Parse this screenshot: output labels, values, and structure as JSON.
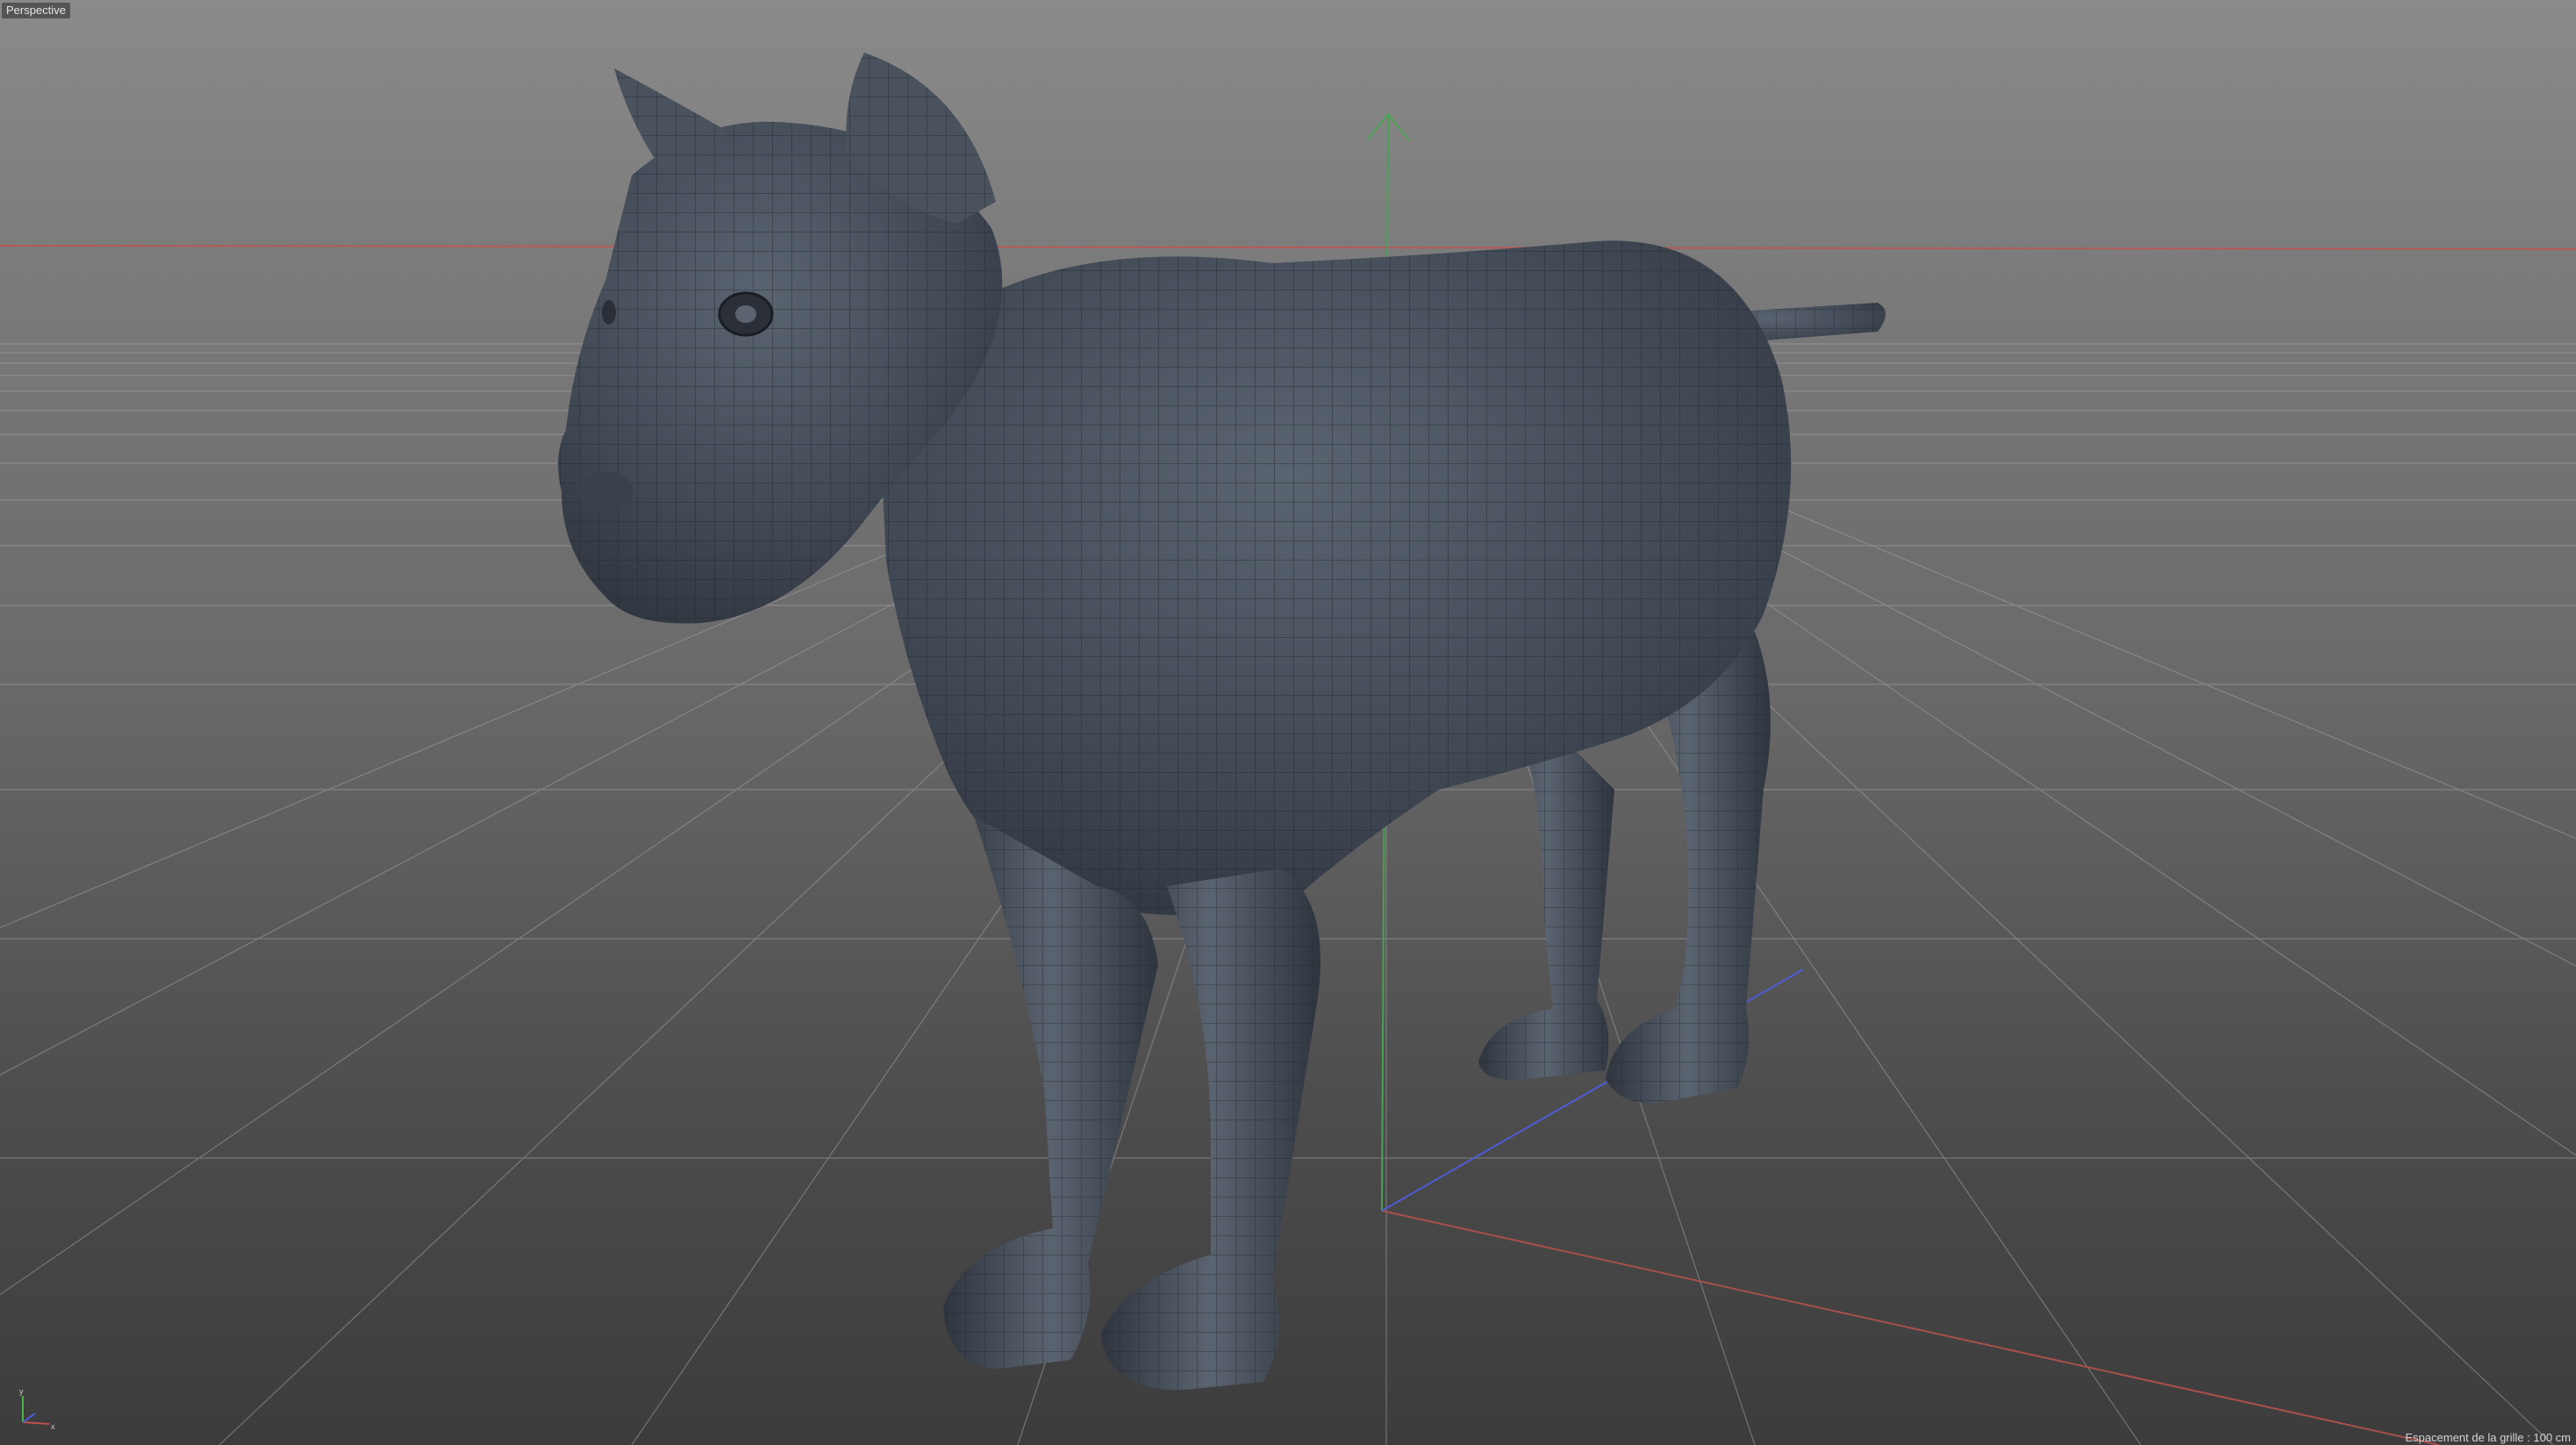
{
  "viewport": {
    "camera_label": "Perspective",
    "grid_spacing_label": "Espacement de la grille : 100 cm"
  },
  "gizmo": {
    "x_label": "x",
    "y_label": "y"
  },
  "colors": {
    "background_top": "#8a8a8a",
    "background_bottom": "#3c3c3c",
    "grid_line": "#9a9a9a",
    "axis_x": "#c0504d",
    "axis_y": "#4caf50",
    "axis_z": "#4f5bd5",
    "mesh_fill": "#3f4752",
    "mesh_wire": "#1f242b"
  },
  "icons": {
    "gizmo": "axis-gizmo-icon",
    "object": "mesh-object-icon"
  }
}
